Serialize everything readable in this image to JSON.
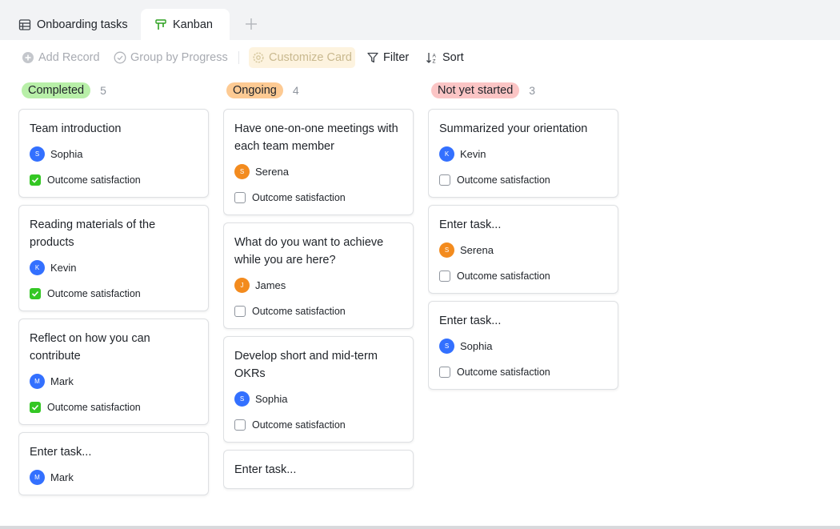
{
  "tabs": [
    {
      "label": "Onboarding tasks",
      "icon": "table-grid-icon"
    },
    {
      "label": "Kanban",
      "icon": "kanban-icon",
      "active": true
    }
  ],
  "toolbar": {
    "add_record": "Add Record",
    "group_by": "Group by Progress",
    "customize_card": "Customize Card",
    "filter": "Filter",
    "sort": "Sort"
  },
  "colors": {
    "completed": "#b8efa8",
    "ongoing": "#fdca93",
    "not_started": "#fbc5c5",
    "checkbox_on": "#34c724"
  },
  "field_label": "Outcome satisfaction",
  "columns": [
    {
      "name": "Completed",
      "count": "5",
      "cards": [
        {
          "title": "Team introduction",
          "owner": "Sophia",
          "initial": "S",
          "checked": true
        },
        {
          "title": "Reading materials of the products",
          "owner": "Kevin",
          "initial": "K",
          "checked": true
        },
        {
          "title": "Reflect on how you can contribute",
          "owner": "Mark",
          "initial": "M",
          "checked": true
        },
        {
          "title": "Enter task...",
          "owner": "Mark",
          "initial": "M",
          "checked": false
        }
      ]
    },
    {
      "name": "Ongoing",
      "count": "4",
      "cards": [
        {
          "title": "Have one-on-one meetings with each team member",
          "owner": "Serena",
          "initial": "S",
          "checked": false
        },
        {
          "title": "What do you want to achieve while you are here?",
          "owner": "James",
          "initial": "J",
          "checked": false
        },
        {
          "title": "Develop short and mid-term OKRs",
          "owner": "Sophia",
          "initial": "S",
          "checked": false
        },
        {
          "title": "Enter task...",
          "owner": "",
          "initial": "",
          "checked": false
        }
      ]
    },
    {
      "name": "Not yet started",
      "count": "3",
      "cards": [
        {
          "title": "Summarized your orientation",
          "owner": "Kevin",
          "initial": "K",
          "checked": false
        },
        {
          "title": "Enter task...",
          "owner": "Serena",
          "initial": "S",
          "checked": false
        },
        {
          "title": "Enter task...",
          "owner": "Sophia",
          "initial": "S",
          "checked": false
        }
      ]
    }
  ]
}
